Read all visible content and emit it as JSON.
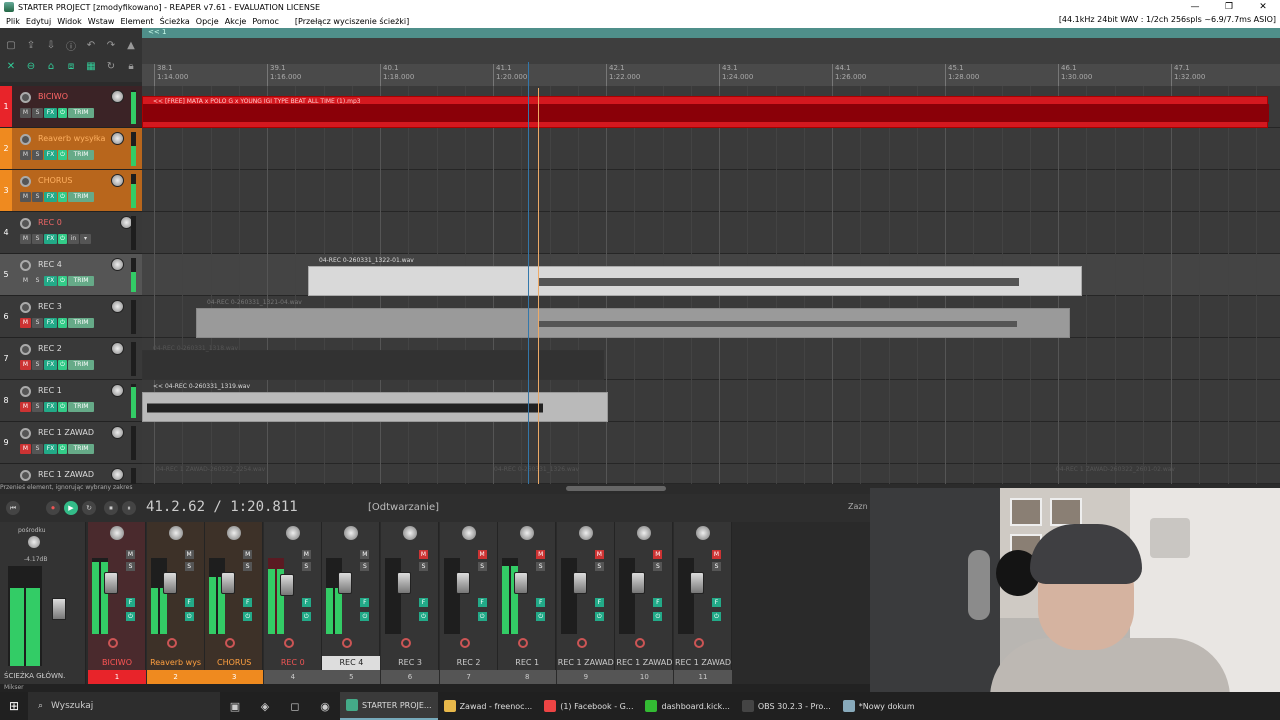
{
  "window": {
    "title": "STARTER PROJECT [zmodyfikowano] - REAPER v7.61 - EVALUATION LICENSE"
  },
  "window_controls": {
    "minimize": "—",
    "maximize": "❐",
    "close": "✕"
  },
  "menu": {
    "items": [
      "Plik",
      "Edytuj",
      "Widok",
      "Wstaw",
      "Element",
      "Ścieżka",
      "Opcje",
      "Akcje",
      "Pomoc"
    ],
    "extra": "[Przełącz wyciszenie ścieżki]",
    "audio_info": "[44.1kHz 24bit WAV : 1/2ch 256spls ~6.9/7.7ms ASIO]"
  },
  "ruler": {
    "loop_marker": "<< 1",
    "marks": [
      {
        "bar": "38.1",
        "time": "1:14.000"
      },
      {
        "bar": "39.1",
        "time": "1:16.000"
      },
      {
        "bar": "40.1",
        "time": "1:18.000"
      },
      {
        "bar": "41.1",
        "time": "1:20.000"
      },
      {
        "bar": "42.1",
        "time": "1:22.000"
      },
      {
        "bar": "43.1",
        "time": "1:24.000"
      },
      {
        "bar": "44.1",
        "time": "1:26.000"
      },
      {
        "bar": "45.1",
        "time": "1:28.000"
      },
      {
        "bar": "46.1",
        "time": "1:30.000"
      },
      {
        "bar": "47.1",
        "time": "1:32.000"
      }
    ]
  },
  "tracks": [
    {
      "num": "1",
      "name": "BICIWO",
      "color": "#e8242a",
      "meter": 0.95
    },
    {
      "num": "2",
      "name": "Reaverb wysyłka",
      "color": "#ef8a1f",
      "meter": 0.6
    },
    {
      "num": "3",
      "name": "CHORUS",
      "color": "#ef8a1f",
      "meter": 0.7
    },
    {
      "num": "4",
      "name": "REC 0",
      "color": "",
      "meter": 0
    },
    {
      "num": "5",
      "name": "REC 4",
      "color": "",
      "meter": 0.6
    },
    {
      "num": "6",
      "name": "REC 3",
      "color": "",
      "meter": 0
    },
    {
      "num": "7",
      "name": "REC 2",
      "color": "",
      "meter": 0
    },
    {
      "num": "8",
      "name": "REC 1",
      "color": "",
      "meter": 0.9
    },
    {
      "num": "9",
      "name": "REC 1 ZAWAD",
      "color": "",
      "meter": 0
    },
    {
      "num": "",
      "name": "REC 1 ZAWAD",
      "color": "",
      "meter": 0
    }
  ],
  "tcp_buttons": {
    "m": "M",
    "s": "S",
    "fx": "FX",
    "trim": "TRIM",
    "in": "in"
  },
  "items": [
    {
      "label": "<< [FREE] MATA x POLO G x YOUNG IGI TYPE BEAT  ALL TIME (1).mp3"
    },
    {
      "label": "04-REC 0-260331_1322-01.wav"
    },
    {
      "label": "04-REC 0-260331_1321-04.wav"
    },
    {
      "label": "04-REC 0-260331_1318.wav"
    },
    {
      "label": "<< 04-REC 0-260331_1319.wav"
    },
    {
      "label": "04-REC 1 ZAWAD-260322_2254.wav"
    },
    {
      "label": "04-REC 0-260331_1326.wav"
    },
    {
      "label": "04-REC 1 ZAWAD-260322_2601-02.wav"
    }
  ],
  "status": "Przenieś element, ignorując wybrany zakres",
  "transport": {
    "time": "41.2.62 / 1:20.811",
    "state": "[Odtwarzanie]",
    "buttons": [
      "⏮",
      "⏺",
      "▶",
      "↻",
      "⏹",
      "⏸"
    ]
  },
  "master": {
    "label": "pośrodku",
    "value": "-4.17dB",
    "name": "ŚCIEŻKA GŁÓWN."
  },
  "mixer": {
    "strips": [
      {
        "name": "BICIWO",
        "num": "1",
        "color": "#e8242a",
        "meter": 0.95
      },
      {
        "name": "Reaverb wys",
        "num": "2",
        "color": "#ef8a1f",
        "meter": 0.6
      },
      {
        "name": "CHORUS",
        "num": "3",
        "color": "#ef8a1f",
        "meter": 0.75
      },
      {
        "name": "REC 0",
        "num": "4",
        "color": "",
        "meter": 0.85
      },
      {
        "name": "REC 4",
        "num": "5",
        "color": "",
        "meter": 0.6
      },
      {
        "name": "REC 3",
        "num": "6",
        "color": "",
        "meter": 0
      },
      {
        "name": "REC 2",
        "num": "7",
        "color": "",
        "meter": 0
      },
      {
        "name": "REC 1",
        "num": "8",
        "color": "",
        "meter": 0.9
      },
      {
        "name": "REC 1 ZAWAD",
        "num": "9",
        "color": "",
        "meter": 0
      },
      {
        "name": "REC 1 ZAWAD",
        "num": "10",
        "color": "",
        "meter": 0
      },
      {
        "name": "REC 1 ZAWAD",
        "num": "11",
        "color": "",
        "meter": 0
      }
    ]
  },
  "side_label": "Zazn",
  "mixer_tab": "Mikser",
  "taskbar": {
    "start_icon": "⊞",
    "search_icon": "⌕",
    "search_placeholder": "Wyszukaj",
    "icons": [
      "▣",
      "◈",
      "◻",
      "◉"
    ],
    "apps": [
      {
        "label": "STARTER PROJE...",
        "color": "#4a8"
      },
      {
        "label": "Zawad - freenoc...",
        "color": "#e8b84a"
      },
      {
        "label": "(1) Facebook - G...",
        "color": "#e44"
      },
      {
        "label": "dashboard.kick...",
        "color": "#3b3"
      },
      {
        "label": "OBS 30.2.3 - Pro...",
        "color": "#444"
      },
      {
        "label": "*Nowy dokum",
        "color": "#8ab"
      }
    ]
  }
}
